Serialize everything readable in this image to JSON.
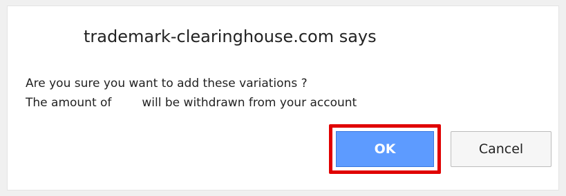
{
  "dialog": {
    "title": "trademark-clearinghouse.com says",
    "message_line1": "Are you sure you want to add these variations ?",
    "message_line2_part1": "The amount of",
    "message_line2_part2": "will be withdrawn from your account",
    "ok_label": "OK",
    "cancel_label": "Cancel"
  },
  "colors": {
    "ok_button": "#5d9bff",
    "highlight": "#e00000"
  }
}
